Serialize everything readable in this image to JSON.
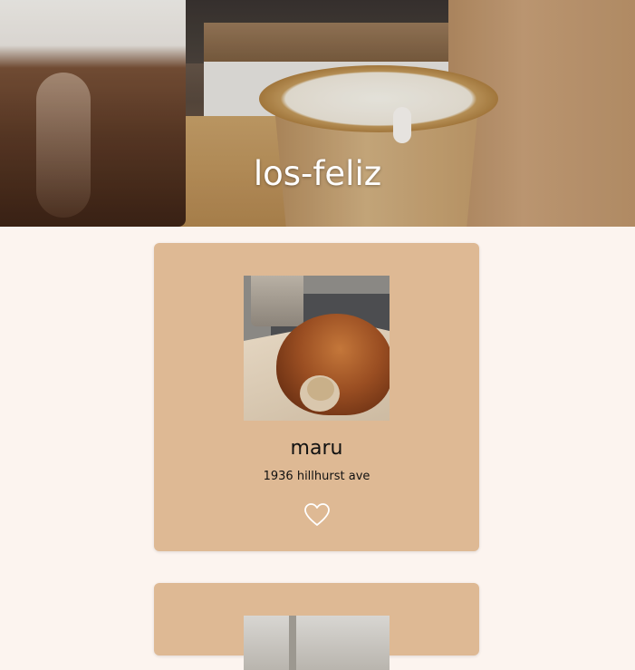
{
  "hero": {
    "title": "los-feliz"
  },
  "cards": [
    {
      "name": "maru",
      "address": "1936 hillhurst ave",
      "favorite_icon": "heart-outline-icon",
      "favorited": false
    }
  ],
  "colors": {
    "page_background": "#fcf4ef",
    "card_background": "#deb994",
    "hero_title": "#ffffff",
    "text": "#111111"
  }
}
